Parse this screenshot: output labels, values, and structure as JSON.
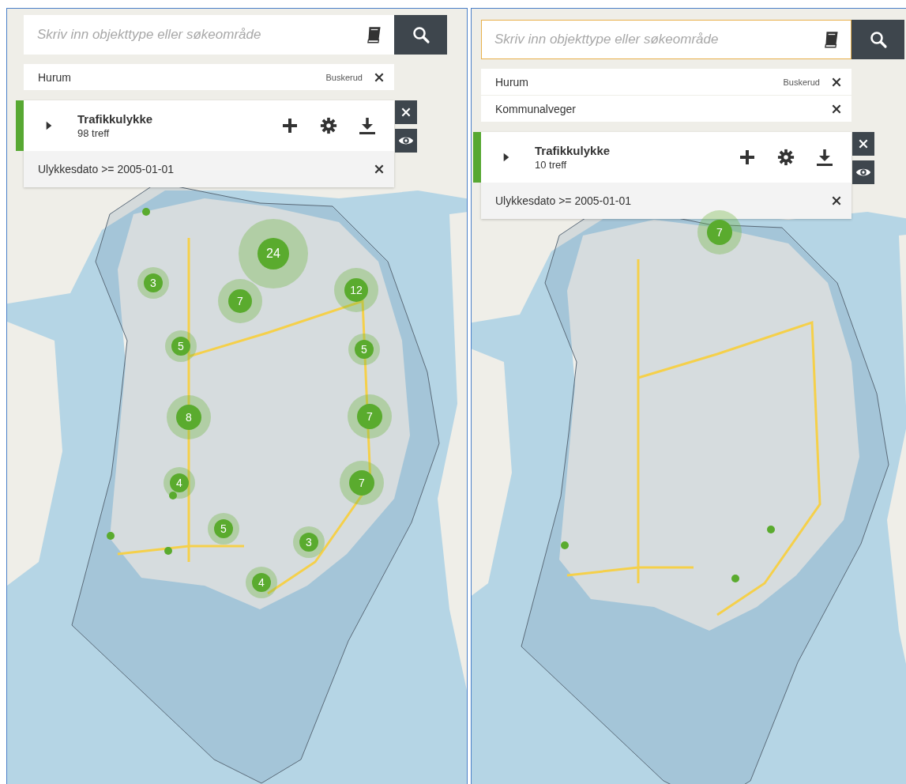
{
  "panels": [
    {
      "search": {
        "placeholder": "Skriv inn objekttype eller søkeområde",
        "focused": false
      },
      "areas": [
        {
          "name": "Hurum",
          "region": "Buskerud"
        }
      ],
      "layer": {
        "title": "Trafikkulykke",
        "count": "98 treff",
        "expanded": false,
        "filters": [
          "Ulykkesdato >= 2005-01-01"
        ]
      },
      "markers": [
        {
          "kind": "cluster",
          "count": "24"
        },
        {
          "kind": "cluster",
          "count": "12"
        },
        {
          "kind": "cluster",
          "count": "7"
        },
        {
          "kind": "cluster",
          "count": "3"
        },
        {
          "kind": "cluster",
          "count": "5"
        },
        {
          "kind": "cluster",
          "count": "5"
        },
        {
          "kind": "cluster",
          "count": "8"
        },
        {
          "kind": "cluster",
          "count": "7"
        },
        {
          "kind": "cluster",
          "count": "7"
        },
        {
          "kind": "cluster",
          "count": "4"
        },
        {
          "kind": "cluster",
          "count": "5"
        },
        {
          "kind": "cluster",
          "count": "3"
        },
        {
          "kind": "cluster",
          "count": "4"
        },
        {
          "kind": "point"
        },
        {
          "kind": "point"
        },
        {
          "kind": "point"
        },
        {
          "kind": "point"
        }
      ]
    },
    {
      "search": {
        "placeholder": "Skriv inn objekttype eller søkeområde",
        "focused": true
      },
      "areas": [
        {
          "name": "Hurum",
          "region": "Buskerud"
        },
        {
          "name": "Kommunalveger"
        }
      ],
      "layer": {
        "title": "Trafikkulykke",
        "count": "10 treff",
        "expanded": false,
        "filters": [
          "Ulykkesdato >= 2005-01-01"
        ]
      },
      "markers": [
        {
          "kind": "cluster",
          "count": "7"
        },
        {
          "kind": "point"
        },
        {
          "kind": "point"
        },
        {
          "kind": "point"
        }
      ]
    }
  ]
}
